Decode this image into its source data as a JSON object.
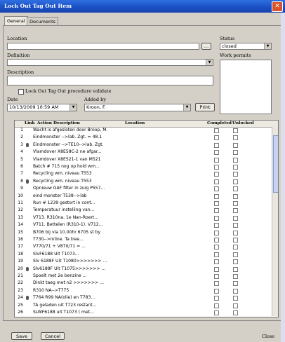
{
  "window": {
    "title": "Lock Out Tag Out Item"
  },
  "tabs": [
    {
      "label": "General"
    },
    {
      "label": "Documents"
    }
  ],
  "form": {
    "location_label": "Location",
    "status_label": "Status",
    "status_value": "closed",
    "definition_label": "Definition",
    "work_permits_label": "Work permits",
    "description_label": "Description",
    "loto_checkbox_label": "Lock Out Tag Out procedure validate",
    "date_label": "Date",
    "date_value": "10/13/2009 10:59 AM",
    "added_by_label": "Added by",
    "added_by_value": "Kroon, F.",
    "print_label": "Print"
  },
  "grid": {
    "columns": [
      "Link",
      "Action Description",
      "Location",
      "Completed",
      "Unlocked"
    ],
    "rows": [
      {
        "n": "1",
        "link": false,
        "desc": "Wacht is afgesloten door Broop, M."
      },
      {
        "n": "2",
        "link": false,
        "desc": "Eindmonster -->lab. Zgt. = 48.1"
      },
      {
        "n": "3",
        "link": true,
        "desc": "Eindmonster -->TE10-->lab. Zgt."
      },
      {
        "n": "4",
        "link": false,
        "desc": "Vlamdover X8E58C-2 ne afgar..."
      },
      {
        "n": "5",
        "link": false,
        "desc": "Vlamdover X8E521-1 van M521"
      },
      {
        "n": "6",
        "link": false,
        "desc": "Batch # 715 nog op hold wm..."
      },
      {
        "n": "7",
        "link": false,
        "desc": "Recycling wm. niveau T553"
      },
      {
        "n": "8",
        "link": true,
        "desc": "Recycling wm. niveau T553"
      },
      {
        "n": "9",
        "link": false,
        "desc": "Opnieuw GAF filter in zuig P557..."
      },
      {
        "n": "10",
        "link": false,
        "desc": "eind monster T538-->lab"
      },
      {
        "n": "11",
        "link": false,
        "desc": "Run # 1239 gestort in cont..."
      },
      {
        "n": "12",
        "link": false,
        "desc": "Temperatuur instelling van..."
      },
      {
        "n": "13",
        "link": false,
        "desc": "V713. R310na. 1e Nan-Roert..."
      },
      {
        "n": "14",
        "link": false,
        "desc": "V711. Bettelen (R310-1). V712..."
      },
      {
        "n": "15",
        "link": false,
        "desc": "B706 bij vla 10.00hr 6705 st by"
      },
      {
        "n": "16",
        "link": false,
        "desc": "T730-->Inline. Ta tree..."
      },
      {
        "n": "17",
        "link": false,
        "desc": "V770/71 + V870/71 = ..."
      },
      {
        "n": "18",
        "link": false,
        "desc": "SlvF6188 Uit T1073..."
      },
      {
        "n": "19",
        "link": false,
        "desc": "Slv 6188F Uit T1080>>>>>>> ..."
      },
      {
        "n": "20",
        "link": true,
        "desc": "Slv6188F Uit T1075>>>>>>> ..."
      },
      {
        "n": "21",
        "link": false,
        "desc": "Spoelt met 2e benzine ..."
      },
      {
        "n": "22",
        "link": false,
        "desc": "Dinkt taeg met n2 >>>>>>> ..."
      },
      {
        "n": "23",
        "link": false,
        "desc": "R310 NA-->T775"
      },
      {
        "n": "24",
        "link": true,
        "desc": "T764 R99 NA(olie) en T783..."
      },
      {
        "n": "25",
        "link": false,
        "desc": "TA geladen uit T723 restant..."
      },
      {
        "n": "26",
        "link": false,
        "desc": "SLWF6188 uit T1073 ( met..."
      }
    ]
  },
  "buttons": {
    "save": "Save",
    "cancel": "Cancel",
    "close": "Close"
  }
}
